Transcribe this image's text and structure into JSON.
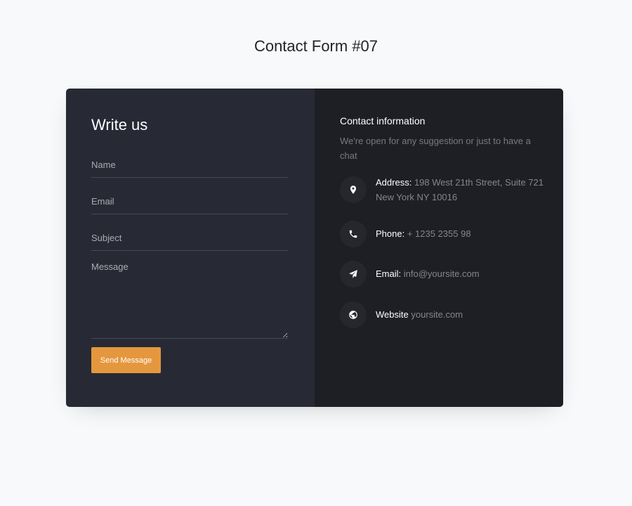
{
  "page": {
    "title": "Contact Form #07"
  },
  "form": {
    "heading": "Write us",
    "name_placeholder": "Name",
    "email_placeholder": "Email",
    "subject_placeholder": "Subject",
    "message_placeholder": "Message",
    "send_label": "Send Message"
  },
  "info": {
    "heading": "Contact information",
    "description": "We're open for any suggestion or just to have a chat",
    "address": {
      "icon": "map-marker-icon",
      "label": "Address:",
      "value": "198 West 21th Street, Suite 721 New York NY 10016"
    },
    "phone": {
      "icon": "phone-icon",
      "label": "Phone:",
      "value": "+ 1235 2355 98"
    },
    "email": {
      "icon": "paper-plane-icon",
      "label": "Email:",
      "value": "info@yoursite.com"
    },
    "website": {
      "icon": "globe-icon",
      "label": "Website",
      "value": "yoursite.com"
    }
  },
  "colors": {
    "page_bg": "#f8f9fa",
    "form_bg": "#272a35",
    "info_bg": "#1e1f24",
    "accent": "#e5973e"
  }
}
